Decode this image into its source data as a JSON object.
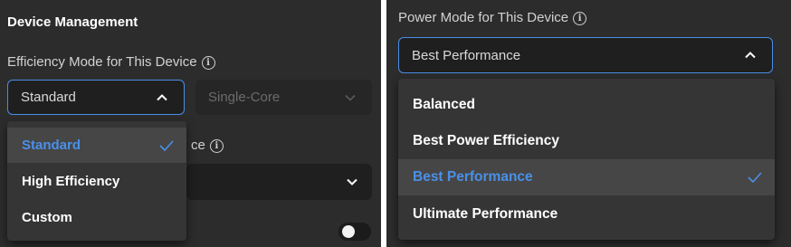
{
  "left": {
    "heading": "Device Management",
    "efficiency_label": "Efficiency Mode for This Device",
    "efficiency_value": "Standard",
    "core_value": "Single-Core",
    "partial_label": "ce",
    "efficiency_options": [
      "Standard",
      "High Efficiency",
      "Custom"
    ],
    "efficiency_selected": "Standard"
  },
  "right": {
    "power_label": "Power Mode for This Device",
    "power_value": "Best Performance",
    "power_options": [
      "Balanced",
      "Best Power Efficiency",
      "Best Performance",
      "Ultimate Performance"
    ],
    "power_selected": "Best Performance"
  },
  "colors": {
    "panel": "#2c2c2c",
    "accent": "#4a8de8",
    "menu": "#353535",
    "selected_row": "#464646"
  },
  "icons": [
    "info-icon",
    "chevron-up-icon",
    "chevron-down-icon",
    "check-icon"
  ]
}
